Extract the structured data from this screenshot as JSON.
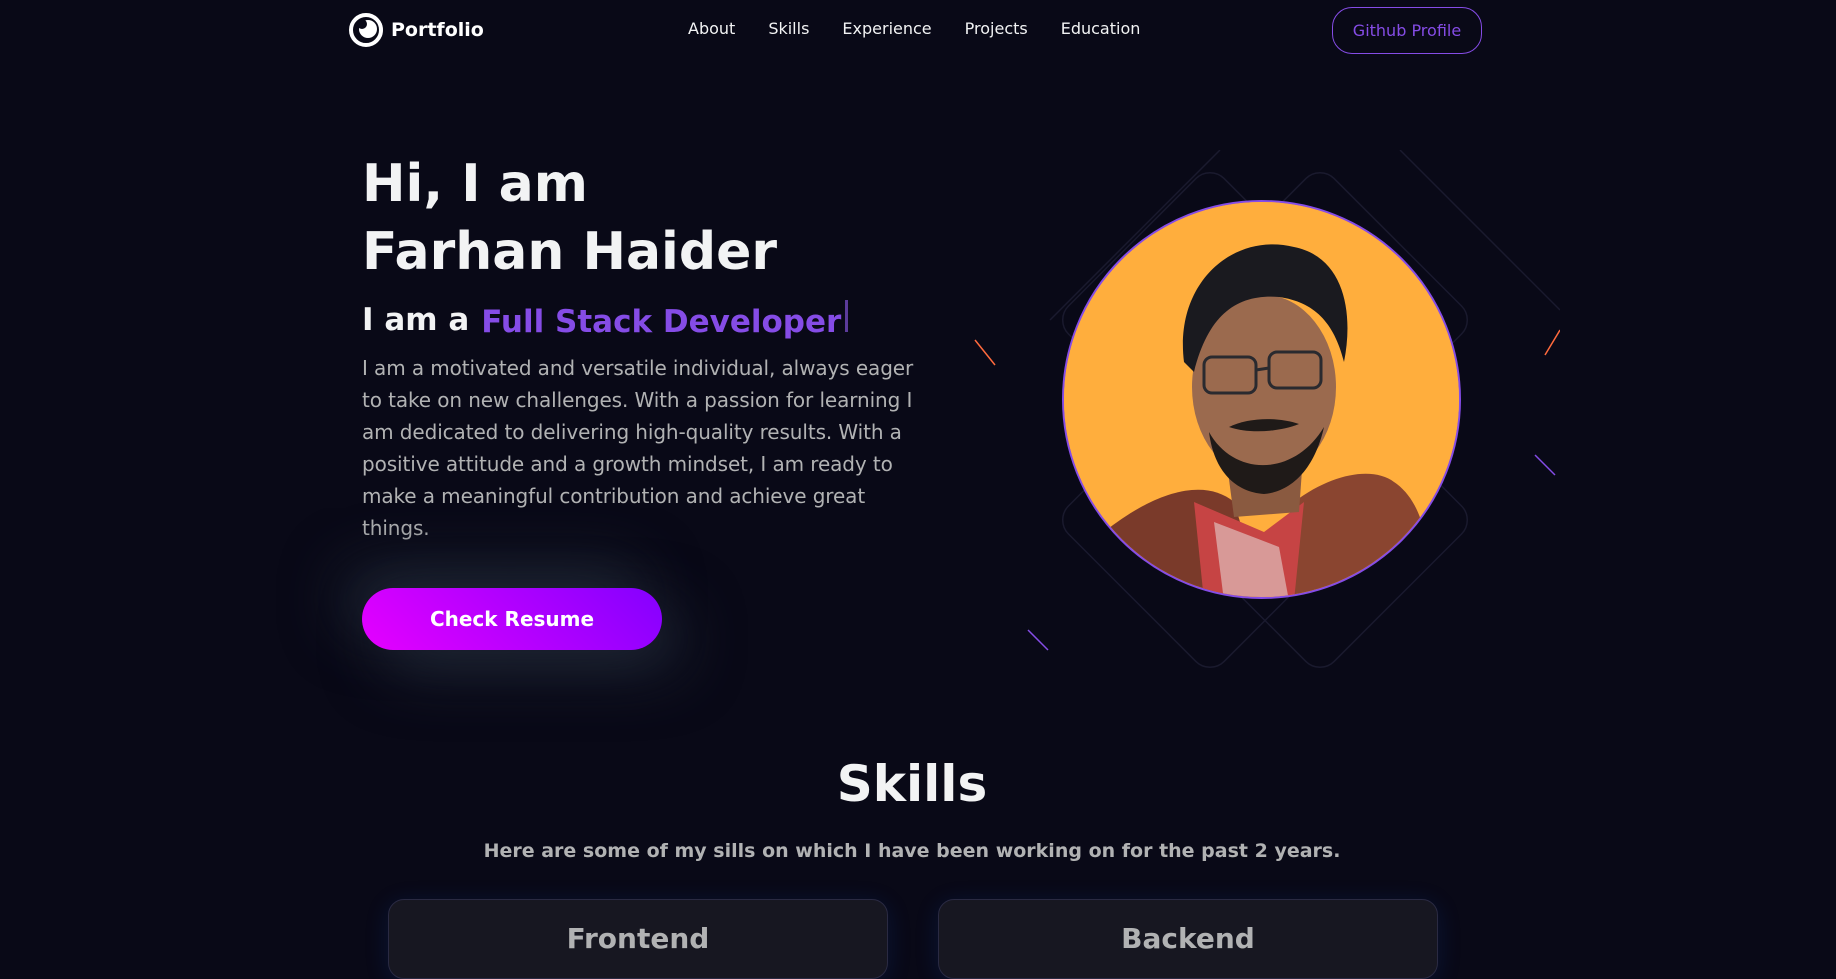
{
  "brand": {
    "name": "Portfolio"
  },
  "nav": {
    "links": [
      "About",
      "Skills",
      "Experience",
      "Projects",
      "Education"
    ],
    "github_label": "Github Profile"
  },
  "hero": {
    "greeting": "Hi, I am",
    "name": "Farhan Haider",
    "role_prefix": "I am a",
    "role": "Full Stack Developer",
    "description": "I am a motivated and versatile individual, always eager to take on new challenges. With a passion for learning I am dedicated to delivering high-quality results. With a positive attitude and a growth mindset, I am ready to make a meaningful contribution and achieve great things.",
    "resume_label": "Check Resume"
  },
  "skills": {
    "title": "Skills",
    "description": "Here are some of my sills on which I have been working on for the past 2 years.",
    "cards": [
      {
        "title": "Frontend"
      },
      {
        "title": "Backend"
      }
    ]
  },
  "colors": {
    "background": "#090917",
    "primary": "#854ce6",
    "text_primary": "#f2f3f4",
    "text_secondary": "#b1b2b3",
    "avatar_bg": "#ffae3d"
  }
}
